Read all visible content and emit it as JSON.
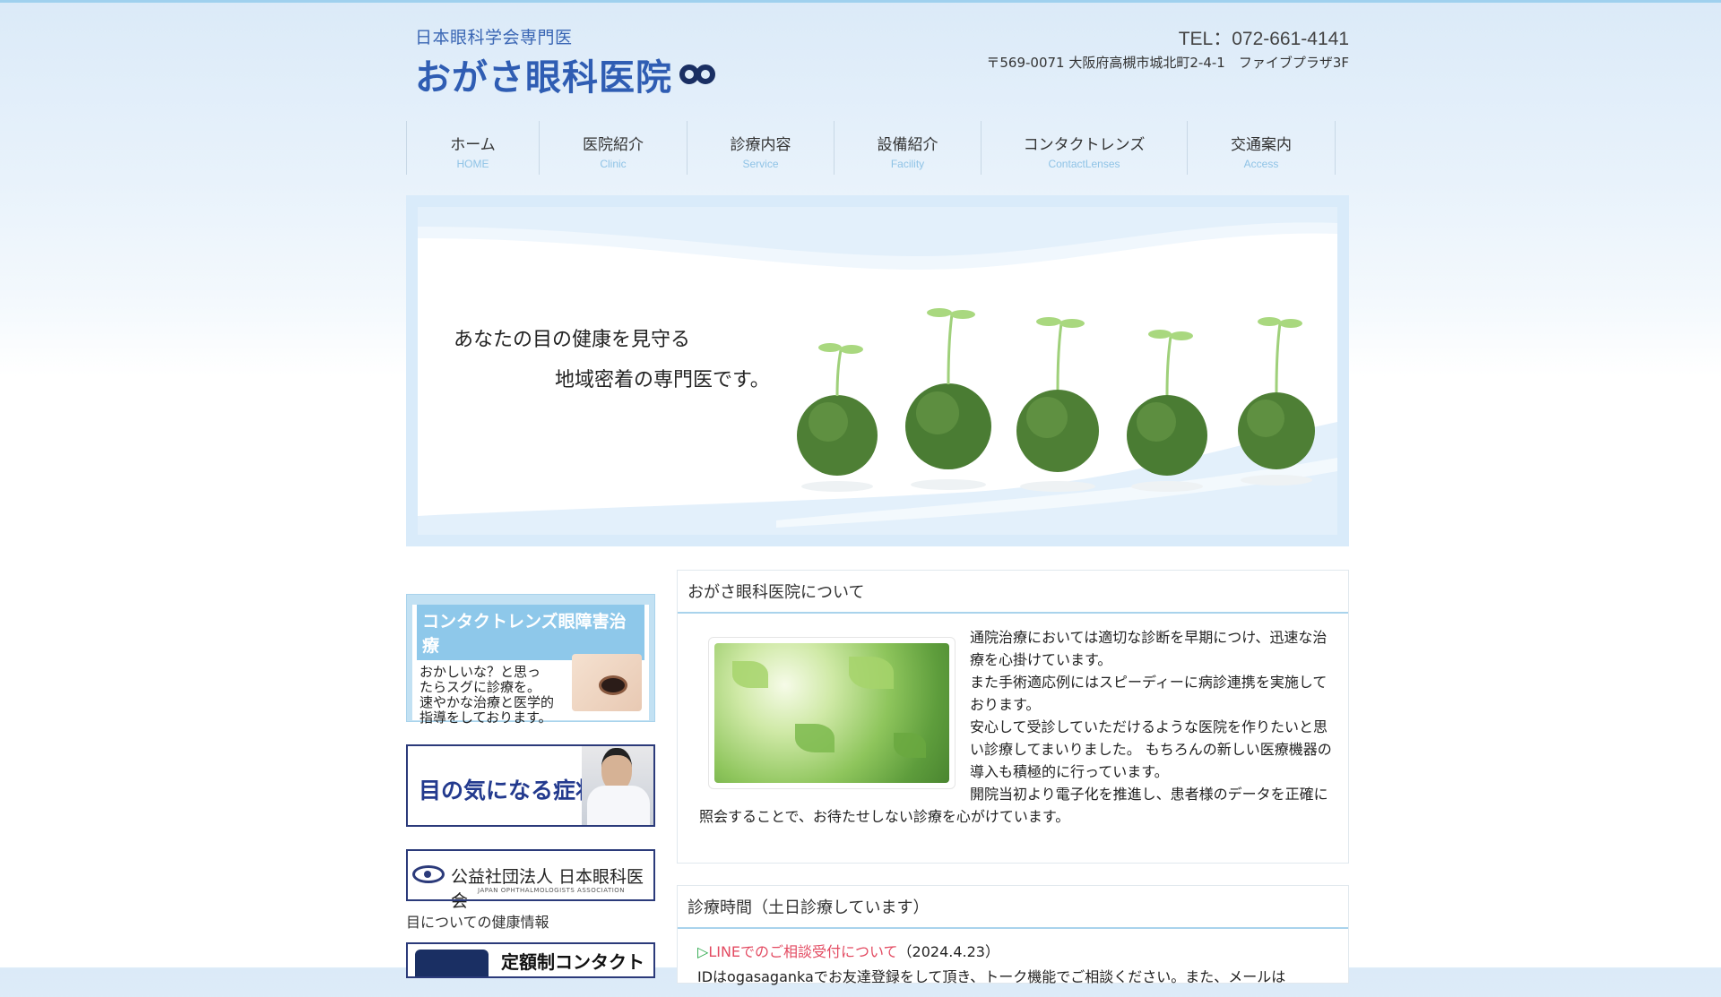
{
  "header": {
    "logo_sub": "日本眼科学会専門医",
    "logo_main": "おがさ眼科医院",
    "tel": "TEL：072-661-4141",
    "address": "〒569-0071 大阪府高槻市城北町2-4-1　ファイブプラザ3F"
  },
  "nav": [
    {
      "jp": "ホーム",
      "en": "HOME"
    },
    {
      "jp": "医院紹介",
      "en": "Clinic"
    },
    {
      "jp": "診療内容",
      "en": "Service"
    },
    {
      "jp": "設備紹介",
      "en": "Facility"
    },
    {
      "jp": "コンタクトレンズ",
      "en": "ContactLenses"
    },
    {
      "jp": "交通案内",
      "en": "Access"
    }
  ],
  "hero": {
    "line1": "あなたの目の健康を見守る",
    "line2": "地域密着の専門医です。"
  },
  "sidebar": {
    "cl_title": "コンタクトレンズ眼障害治療",
    "cl_text": [
      "おかしいな？と思っ",
      "たらスグに診療を。",
      "速やかな治療と医学的",
      "指導をしております。"
    ],
    "symptom": "目の気になる症状",
    "jo_name": "公益社団法人 日本眼科医会",
    "jo_en": "JAPAN OPHTHALMOLOGISTS ASSOCIATION",
    "health": "目についての健康情報",
    "teigaku": "定額制コンタクト"
  },
  "about": {
    "title": "おがさ眼科医院について",
    "paragraphs": [
      "通院治療においては適切な診断を早期につけ、迅速な治療を心掛けています。",
      "また手術適応例にはスピーディーに病診連携を実施しております。",
      "安心して受診していただけるような医院を作りたいと思い診療してまいりました。 もちろんの新しい医療機器の導入も積極的に行っています。",
      "開院当初より電子化を推進し、患者様のデータを正確に照会することで、お待たせしない診療を心がけています。"
    ]
  },
  "hours": {
    "title": "診療時間（土日診療しています）",
    "news_arrow": "▷",
    "news_link": "LINEでのご相談受付について",
    "news_date": "（2024.4.23）",
    "news_more": "IDはogasagankaでお友達登録をして頂き、トーク機能でご相談ください。また、メールは"
  },
  "colors": {
    "accent": "#2f5db3",
    "nav_en": "#8fc3e6",
    "line": "#a9d3ec",
    "news_link": "#e34b62"
  }
}
